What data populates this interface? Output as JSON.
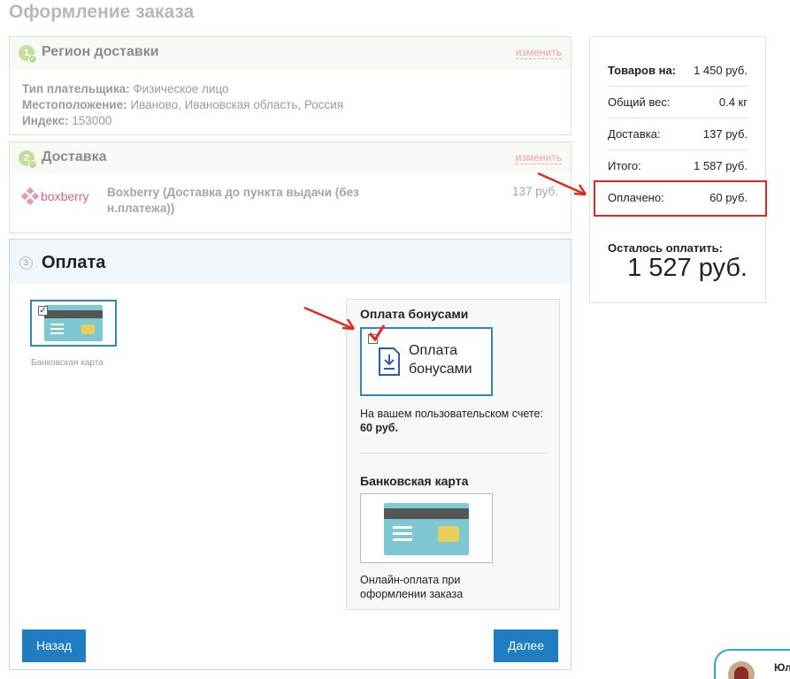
{
  "page": {
    "title": "Оформление заказа"
  },
  "region": {
    "number": "1",
    "title": "Регион доставки",
    "change_label": "изменить",
    "payer_type_label": "Тип плательщика:",
    "payer_type_value": " Физическое лицо",
    "location_label": "Местоположение:",
    "location_value": " Иваново, Ивановская область, Россия",
    "index_label": "Индекс:",
    "index_value": " 153000"
  },
  "delivery": {
    "number": "2",
    "title": "Доставка",
    "change_label": "изменить",
    "logo_text": "boxberry",
    "service_name": "Boxberry (Доставка до пункта выдачи (без н.платежа))",
    "price": "137 руб."
  },
  "payment": {
    "number": "3",
    "title": "Оплата",
    "selected_method_caption": "Банковская карта",
    "bonus": {
      "heading": "Оплата бонусами",
      "tile_line1": "Оплата",
      "tile_line2": "бонусами",
      "balance_text": "На вашем пользовательском счете: ",
      "balance_value": "60 руб."
    },
    "bank_card": {
      "heading": "Банковская карта",
      "description": "Онлайн-оплата при оформлении заказа"
    },
    "back_button": "Назад",
    "next_button": "Далее"
  },
  "summary": {
    "goods_label": "Товаров на:",
    "goods_value": "1 450 руб.",
    "weight_label": "Общий вес:",
    "weight_value": "0.4 кг",
    "delivery_label": "Доставка:",
    "delivery_value": "137 руб.",
    "total_label": "Итого:",
    "total_value": "1 587 руб.",
    "paid_label": "Оплачено:",
    "paid_value": "60 руб.",
    "remaining_label": "Осталось оплатить:",
    "remaining_value": "1 527 руб."
  },
  "chat": {
    "name": "Юл"
  },
  "colors": {
    "accent_blue": "#1f7ec2",
    "highlight_red": "#e0281e",
    "done_green": "#c4df9b",
    "card_teal": "#7ec8d3"
  }
}
